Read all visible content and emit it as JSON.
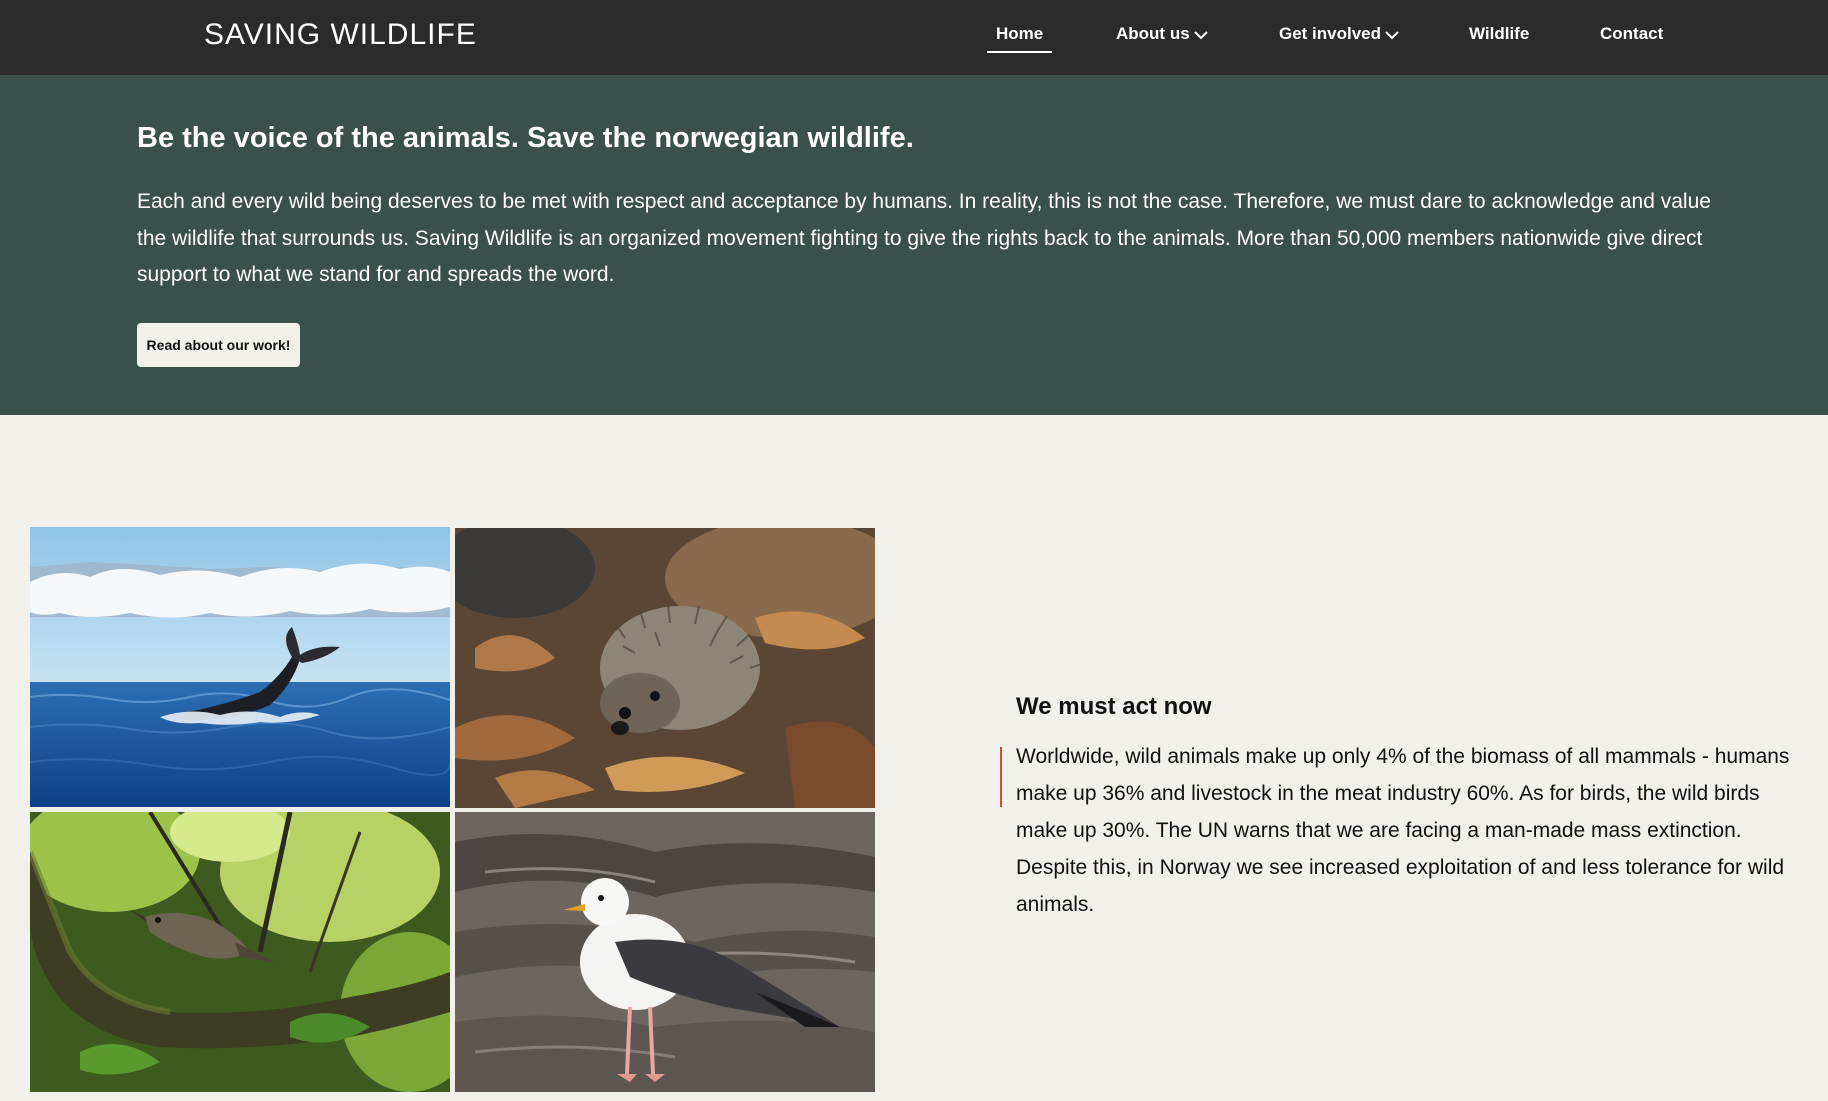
{
  "nav": {
    "logo": "SAVING WILDLIFE",
    "items": [
      {
        "label": "Home",
        "active": true,
        "dropdown": false
      },
      {
        "label": "About us",
        "active": false,
        "dropdown": true
      },
      {
        "label": "Get involved",
        "active": false,
        "dropdown": true
      },
      {
        "label": "Wildlife",
        "active": false,
        "dropdown": false
      },
      {
        "label": "Contact",
        "active": false,
        "dropdown": false
      }
    ]
  },
  "hero": {
    "title": "Be the voice of the animals. Save the norwegian wildlife.",
    "body": "Each and every wild being deserves to be met with respect and acceptance by humans. In reality, this is not the case. Therefore, we must dare to acknowledge and value the wildlife that surrounds us. Saving Wildlife is an organized movement fighting to give the rights back to the animals. More than 50,000 members nationwide give direct support to what we stand for and spreads the word.",
    "button_label": "Read about our work!"
  },
  "gallery": {
    "photos": [
      "whale-tail",
      "hedgehog",
      "bird-on-branch",
      "seagull"
    ]
  },
  "section": {
    "heading": "We must act now",
    "body": "Worldwide, wild animals make up only 4% of the biomass of all mammals - humans make up 36% and livestock in the meat industry 60%. As for birds, the wild birds make up 30%. The UN warns that we are facing a man-made mass extinction. Despite this, in Norway we see increased exploitation of and less tolerance for wild animals."
  },
  "colors": {
    "nav_bg": "#2b2b2b",
    "hero_bg": "#3a504a",
    "page_bg": "#f2f0eb",
    "accent": "#c9552f"
  }
}
